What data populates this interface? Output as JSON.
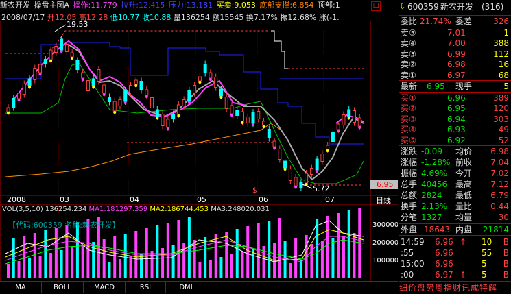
{
  "colors": {
    "up": "#ff4040",
    "down": "#00ffff",
    "frame": "#b00000",
    "bg": "#000000"
  },
  "header": {
    "stock_name": "新农开发",
    "indicator_name": "操盘主图A",
    "op_label": "操作:11.779",
    "pull_label": "拉升:12.415",
    "pressure_label": "压力:13.181",
    "trade_label": "买卖:9.053",
    "support_label": "底部支撑:6.854",
    "top_label": "顶部:1"
  },
  "bar_info": {
    "date": "2008/07/17",
    "open": "开12.05",
    "high": "高12.28",
    "low": "低10.77",
    "close": "收10.88",
    "volume": "量136254",
    "amount": "额15545",
    "turnover": "换7.17%",
    "amplitude": "振12.68%",
    "change": "涨(-1."
  },
  "main_chart": {
    "high_label": "19.53",
    "low_label": "5.72",
    "price_tag": "6.95",
    "month_labels": [
      "2008",
      "03",
      "04",
      "05",
      "06",
      "07"
    ],
    "period_label": "日线"
  },
  "vol_chart": {
    "header": {
      "title": "VOL(3,5,10)",
      "value": "136254.234",
      "ma1": "MA1:181297.359",
      "ma2": "MA2:186744.453",
      "ma3": "MA3:248020.031"
    },
    "watermark": "【代码:600359 名称:新农开发】",
    "y_ticks": [
      "300000",
      "200000",
      "100000"
    ]
  },
  "tabs": [
    "MA",
    "BOLL",
    "MACD",
    "RSI",
    "DMI"
  ],
  "panel": {
    "code": "600359",
    "name": "新农开发",
    "num": "(316)",
    "weibi_label": "委比",
    "weibi_val": "21.74%",
    "weicha_label": "委差",
    "weicha_val": "326",
    "asks": [
      {
        "label": "卖⑤",
        "price": "7.01",
        "vol": "1"
      },
      {
        "label": "卖④",
        "price": "7.00",
        "vol": "388"
      },
      {
        "label": "卖③",
        "price": "6.99",
        "vol": "112"
      },
      {
        "label": "卖②",
        "price": "6.98",
        "vol": "16"
      },
      {
        "label": "卖①",
        "price": "6.97",
        "vol": "68"
      }
    ],
    "last_label": "最新",
    "last_val": "6.95",
    "now_label": "现手",
    "now_val": "5",
    "bids": [
      {
        "label": "买①",
        "price": "6.96",
        "vol": "389"
      },
      {
        "label": "买②",
        "price": "6.95",
        "vol": "120"
      },
      {
        "label": "买③",
        "price": "6.94",
        "vol": "303"
      },
      {
        "label": "买④",
        "price": "6.93",
        "vol": "49"
      },
      {
        "label": "买⑤",
        "price": "6.92",
        "vol": "52"
      }
    ],
    "stats": [
      {
        "l1": "涨跌",
        "v1": "-0.09",
        "l2": "均价",
        "v2": "6.98"
      },
      {
        "l1": "涨幅",
        "v1": "-1.28%",
        "l2": "前收",
        "v2": "7.04"
      },
      {
        "l1": "振幅",
        "v1": "4.69%",
        "l2": "今开",
        "v2": "7.02"
      },
      {
        "l1": "总手",
        "v1": "40456",
        "l2": "最高",
        "v2": "7.12"
      },
      {
        "l1": "总额",
        "v1": "2824",
        "l2": "最低",
        "v2": "6.79"
      },
      {
        "l1": "换手",
        "v1": "2.13%",
        "l2": "量比",
        "v2": "0.44"
      },
      {
        "l1": "分笔",
        "v1": "1327",
        "l2": "均量",
        "v2": "30"
      }
    ],
    "outer_label": "外盘",
    "outer_val": "18643",
    "inner_label": "内盘",
    "inner_val": "21814",
    "ticks": [
      {
        "time": "14:59",
        "price": "6.96",
        "arrow": "↑",
        "vol": "10",
        "side": "B"
      },
      {
        "time": ":55",
        "price": "6.96",
        "arrow": "",
        "vol": "55",
        "side": "B"
      },
      {
        "time": "15:00",
        "price": "6.96",
        "arrow": "",
        "vol": "5",
        "side": "B"
      },
      {
        "time": ":00",
        "price": "6.97",
        "arrow": "↑",
        "vol": "5",
        "side": "B"
      }
    ],
    "bottom_tabs": "细价盘势周指财讯成特解"
  }
}
